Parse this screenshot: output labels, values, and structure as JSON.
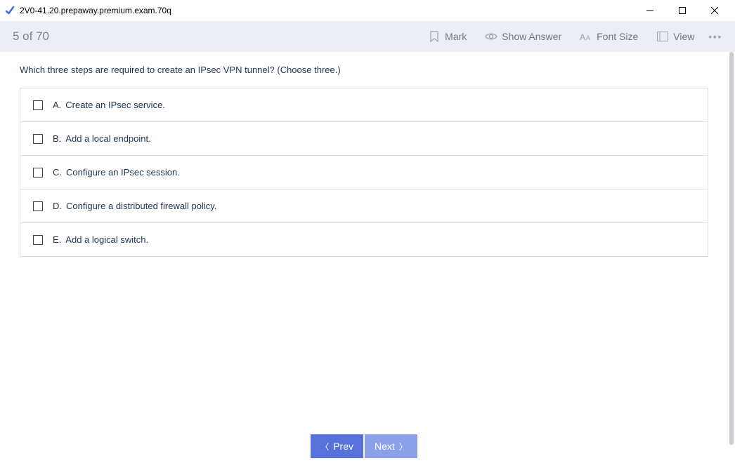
{
  "window": {
    "title": "2V0-41.20.prepaway.premium.exam.70q"
  },
  "toolbar": {
    "progress": "5 of 70",
    "mark": "Mark",
    "show_answer": "Show Answer",
    "font_size": "Font Size",
    "view": "View"
  },
  "question": {
    "text": "Which three steps are required to create an IPsec VPN tunnel? (Choose three.)"
  },
  "options": [
    {
      "letter": "A.",
      "text": "Create an IPsec service."
    },
    {
      "letter": "B.",
      "text": "Add a local endpoint."
    },
    {
      "letter": "C.",
      "text": "Configure an IPsec session."
    },
    {
      "letter": "D.",
      "text": "Configure a distributed firewall policy."
    },
    {
      "letter": "E.",
      "text": "Add a logical switch."
    }
  ],
  "footer": {
    "prev": "Prev",
    "next": "Next"
  }
}
